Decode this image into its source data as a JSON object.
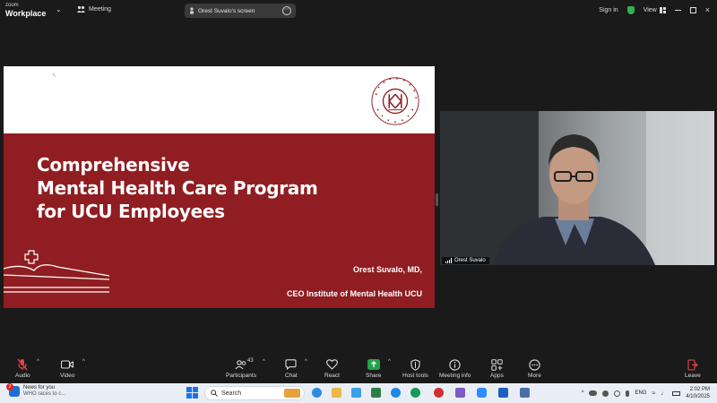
{
  "app": {
    "brand_line1": "zoom",
    "brand_line2": "Workplace",
    "meeting_label": "Meeting",
    "share_pill": "Orest Suvalo's screen",
    "sign_in": "Sign in",
    "view": "View"
  },
  "slide": {
    "title_lines": [
      "Comprehensive",
      "Mental Health Care Program",
      "for UCU Employees"
    ],
    "speaker": "Orest Suvalo, MD,",
    "speaker_role": "CEO Institute of Mental Health UCU",
    "logo_text": "UKRAINIAN CATHOLIC UNIVERSITY",
    "colors": {
      "band": "#8f1d21",
      "top": "#ffffff"
    }
  },
  "video": {
    "name": "Orest Suvalo"
  },
  "controls": {
    "audio": "Audio",
    "video": "Video",
    "participants": "Participants",
    "participants_count": "43",
    "chat": "Chat",
    "react": "React",
    "share": "Share",
    "host_tools": "Host tools",
    "meeting_info": "Meeting info",
    "apps": "Apps",
    "more": "More",
    "leave": "Leave"
  },
  "taskbar": {
    "news_title": "News for you",
    "news_sub": "WHO races to c...",
    "news_badge": "2",
    "search_placeholder": "Search",
    "lang": "ENG",
    "time": "2:02 PM",
    "date": "4/10/2025"
  }
}
